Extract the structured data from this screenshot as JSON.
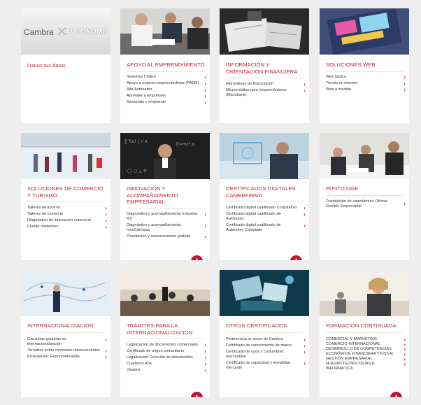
{
  "cards": [
    {
      "title": "",
      "logo": {
        "left": "Cambra",
        "right": "AUTÒNOMS"
      },
      "subtitle": "Danos tus datos",
      "items": []
    },
    {
      "title": "APOYO AL EMPRENDIMIENTO",
      "items": [
        "Sesiones CreEm",
        "Apoyo a mujeres emprendedoras (PAEM)",
        "Alta Autónomo",
        "Aprender a emprender",
        "Asesórate y emprende"
      ]
    },
    {
      "title": "INFORMACIÓN Y ORIENTACIÓN FINANCIERA",
      "items": [
        "Alternativas de financiación",
        "Microcréditos para emprendedores (Microbank)"
      ]
    },
    {
      "title": "SOLUCIONES WEB",
      "items": [
        "Web básica",
        "Tienda en internet",
        "Web a medida"
      ]
    },
    {
      "title": "SOLUCIONES DE COMERCIO Y TURISMO",
      "items": [
        "Talleres de turismo",
        "Talleres de comercio",
        "Diagnóstico de innovación comercial",
        "Cliente misterioso"
      ]
    },
    {
      "title": "INNOVACIÓN Y ACOMPAÑAMIENTO EMPRESARIAL",
      "items": [
        "Diagnóstico y acompañamiento Industria 4.0",
        "Diagnóstico y acompañamiento InnoCámaras",
        "Orientación y asesoramiento gratuito"
      ]
    },
    {
      "title": "CERTIFICADOS DIGITALES CAMERFIRMA",
      "items": [
        "Certificado digital cualificado Corporativo",
        "Certificado digital cualificado de Autónomo",
        "Certificado digital cualificado de Autónomo Colegiado"
      ]
    },
    {
      "title": "PUNTO OGE",
      "items": [
        "Tramitación de expedientes Oficina Gestión Empresarial"
      ]
    },
    {
      "title": "INTERNACIONALIZACIÓN",
      "items": [
        "Consultas gratuitas en internacionalización",
        "Jornadas sobre mercados internacionales",
        "iOrientación: Exportmetropolis"
      ]
    },
    {
      "title": "TRÁMITES PARA LA INTERNACIONALIZACIÓN",
      "items": [
        "Legalización de documentos comerciales",
        "Certificado de origen comunitario",
        "Legalización Consular de documentos",
        "Cuaderno ATA",
        "Visados"
      ]
    },
    {
      "title": "OTROS CERTIFICADOS",
      "items": [
        "Pertenencia al censo de Cambra",
        "Certificado de conocimiento de marca",
        "Certificado de usos y costumbres mercantiles",
        "Certificado de capacidad y moralidad mercantil"
      ]
    },
    {
      "title": "FORMACIÓN CONTINUADA",
      "items": [
        "COMERCIAL Y MARKETING",
        "COMERCIO INTERNACIONAL",
        "DESARROLLO DE COMPETENCIAS",
        "ECONÓMICA, FINANCIERA Y FISCAL",
        "GESTIÓN EMPRESARIAL",
        "NUEVAS TECNOLOGÍAS E INFORMÁTICA"
      ]
    }
  ],
  "plus_label": "+",
  "arrow": "›"
}
